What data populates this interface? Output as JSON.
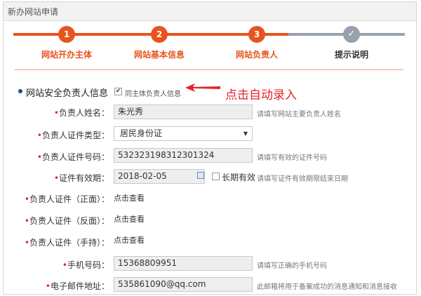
{
  "window": {
    "title": "新办网站申请"
  },
  "stepper": {
    "steps": [
      {
        "number": "1",
        "label": "网站开办主体",
        "state": "active"
      },
      {
        "number": "2",
        "label": "网站基本信息",
        "state": "active"
      },
      {
        "number": "3",
        "label": "网站负责人",
        "state": "active"
      },
      {
        "number": "✓",
        "label": "提示说明",
        "state": "done"
      }
    ],
    "active_color": "#e8541e",
    "inactive_color": "#98a2ae"
  },
  "section": {
    "title": "网站安全负责人信息",
    "same_as_owner_label": "同主体负责人信息",
    "same_as_owner_checked": true,
    "annotation": "点击自动录入"
  },
  "form": {
    "name": {
      "label": "负责人姓名：",
      "value": "朱光秀",
      "hint": "请填写网站主要负责人姓名"
    },
    "id_type": {
      "label": "负责人证件类型：",
      "value": "居民身份证"
    },
    "id_number": {
      "label": "负责人证件号码：",
      "value": "532323198312301324",
      "hint": "请填写有效的证件号码"
    },
    "validity": {
      "label": "证件有效期：",
      "value": "2018-02-05",
      "long_term_label": "长期有效",
      "hint": "请填写证件有效期限结束日期"
    },
    "id_front": {
      "label": "负责人证件（正面）：",
      "link": "点击查看"
    },
    "id_back": {
      "label": "负责人证件（反面）：",
      "link": "点击查看"
    },
    "id_handheld": {
      "label": "负责人证件（手持）：",
      "link": "点击查看"
    },
    "phone": {
      "label": "手机号码：",
      "value": "15368809951",
      "hint": "请填写正确的手机号码"
    },
    "email": {
      "label": "电子邮件地址：",
      "value": "535861090@qq.com",
      "hint": "此邮箱将用于备案成功的消息通知和消息接收"
    }
  },
  "required_mark": "•"
}
